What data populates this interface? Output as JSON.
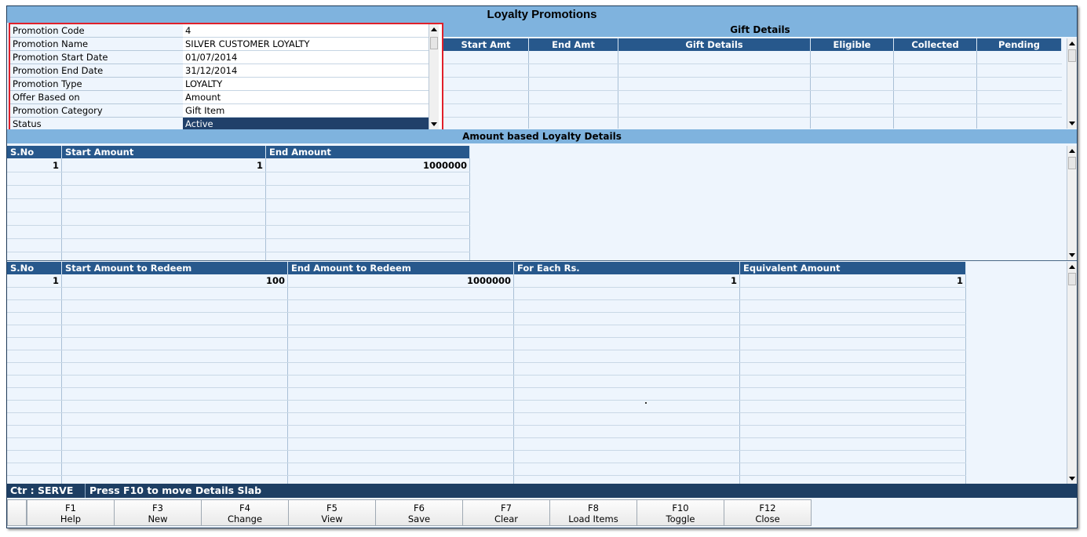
{
  "window": {
    "title": "Loyalty Promotions"
  },
  "form": {
    "rows": [
      {
        "label": "Promotion Code",
        "value": "4"
      },
      {
        "label": "Promotion Name",
        "value": "SILVER CUSTOMER LOYALTY"
      },
      {
        "label": "Promotion Start Date",
        "value": "01/07/2014"
      },
      {
        "label": "Promotion End Date",
        "value": "31/12/2014"
      },
      {
        "label": "Promotion Type",
        "value": "LOYALTY"
      },
      {
        "label": "Offer Based on",
        "value": "Amount"
      },
      {
        "label": "Promotion Category",
        "value": "Gift Item"
      },
      {
        "label": "Status",
        "value": "Active"
      }
    ]
  },
  "gift_details": {
    "section_title": "Gift Details",
    "columns": [
      "Start Amt",
      "End Amt",
      "Gift Details",
      "Eligible",
      "Collected",
      "Pending"
    ]
  },
  "amount_loyalty": {
    "section_title": "Amount based Loyalty Details",
    "columns": [
      "S.No",
      "Start Amount",
      "End Amount"
    ],
    "rows": [
      {
        "sno": "1",
        "start": "1",
        "end": "1000000"
      }
    ]
  },
  "redeem": {
    "columns": [
      "S.No",
      "Start Amount to Redeem",
      "End Amount to Redeem",
      "For Each Rs.",
      "Equivalent Amount"
    ],
    "rows": [
      {
        "sno": "1",
        "start": "100",
        "end": "1000000",
        "each": "1",
        "equiv": "1"
      }
    ]
  },
  "status_bar": {
    "counter": "Ctr : SERVE",
    "hint": "Press F10 to move Details Slab"
  },
  "fkeys": [
    {
      "key": "F1",
      "label": "Help"
    },
    {
      "key": "F3",
      "label": "New"
    },
    {
      "key": "F4",
      "label": "Change"
    },
    {
      "key": "F5",
      "label": "View"
    },
    {
      "key": "F6",
      "label": "Save"
    },
    {
      "key": "F7",
      "label": "Clear"
    },
    {
      "key": "F8",
      "label": "Load Items"
    },
    {
      "key": "F10",
      "label": "Toggle"
    },
    {
      "key": "F12",
      "label": "Close"
    }
  ]
}
